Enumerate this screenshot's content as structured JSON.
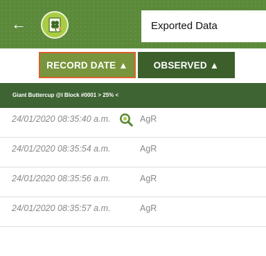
{
  "app_bar": {
    "back_icon": "arrow-left-icon",
    "logo_icon": "clover-document-logo",
    "title": "Exported Data",
    "colors": {
      "bar": "#5b8a3a",
      "logo": "#a9cc45"
    }
  },
  "sort_buttons": {
    "record_date": "RECORD DATE ▲",
    "observed": "OBSERVED ▲",
    "colors": {
      "active_border": "#d9622b",
      "date_bg": "#78953d",
      "observed_bg": "#3c5f2c"
    }
  },
  "table": {
    "header": "Giant Buttercup @I Block #0001 > 25% <",
    "header_color": "#3e6433",
    "rows": [
      {
        "date": "24/01/2020 08:35:40 a.m.",
        "observed": "AgR",
        "icon": "search-icon"
      },
      {
        "date": "24/01/2020 08:35:54 a.m.",
        "observed": "AgR"
      },
      {
        "date": "24/01/2020 08:35:56 a.m.",
        "observed": "AgR"
      },
      {
        "date": "24/01/2020 08:35:57 a.m.",
        "observed": "AgR"
      }
    ]
  }
}
